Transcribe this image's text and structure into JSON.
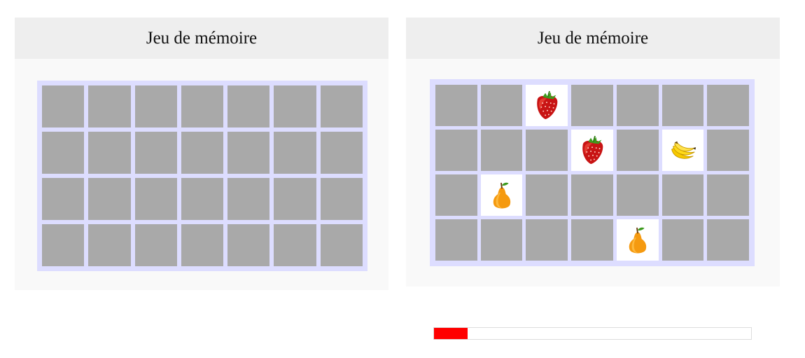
{
  "games": [
    {
      "title": "Jeu de mémoire",
      "grid": {
        "rows": 4,
        "cols": 7,
        "cards": [
          [
            null,
            null,
            null,
            null,
            null,
            null,
            null
          ],
          [
            null,
            null,
            null,
            null,
            null,
            null,
            null
          ],
          [
            null,
            null,
            null,
            null,
            null,
            null,
            null
          ],
          [
            null,
            null,
            null,
            null,
            null,
            null,
            null
          ]
        ]
      }
    },
    {
      "title": "Jeu de mémoire",
      "grid": {
        "rows": 4,
        "cols": 7,
        "cards": [
          [
            null,
            null,
            "strawberry-icon",
            null,
            null,
            null,
            null
          ],
          [
            null,
            null,
            null,
            "strawberry-icon",
            null,
            "banana-icon",
            null
          ],
          [
            null,
            "pear-icon",
            null,
            null,
            null,
            null,
            null
          ],
          [
            null,
            null,
            null,
            null,
            "pear-icon",
            null,
            null
          ]
        ]
      },
      "timer_progress": 0.105
    }
  ],
  "colors": {
    "card_back": "#a9a9a9",
    "card_face": "#ffffff",
    "board_bg": "#ddddff",
    "progress": "#ff0000"
  }
}
